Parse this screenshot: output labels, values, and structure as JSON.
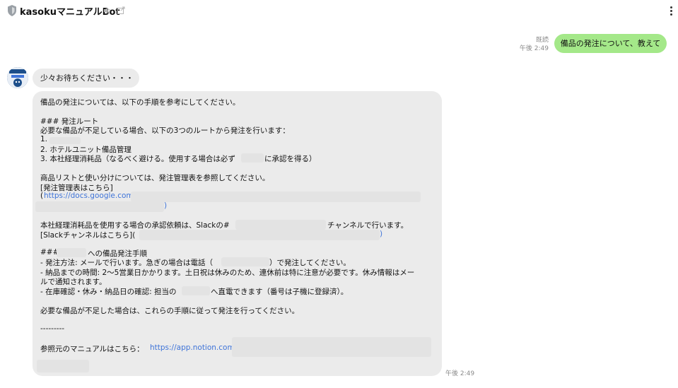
{
  "header": {
    "title": "kasokuマニュアルBot"
  },
  "outgoing": {
    "read_label": "既読",
    "time": "午後 2:49",
    "text": "備品の発注について、教えて"
  },
  "incoming": {
    "waiting_text": "少々お待ちください・・・",
    "time": "午後 2:49",
    "lines": {
      "l1": "備品の発注については、以下の手順を参考にしてください。",
      "l2": "### 発注ルート",
      "l3": "必要な備品が不足している場合、以下の3つのルートから発注を行います：",
      "l4": "1.",
      "l5": "2. ホテルユニット備品管理",
      "l6a": "3. 本社経理消耗品（なるべく避ける。使用する場合は必ず",
      "l6b": "に承認を得る）",
      "l7": "商品リストと使い分けについては、発注管理表を参照してください。",
      "l8": "[発注管理表はこちら]",
      "l9a": "(",
      "l9b": "https://docs.google.com",
      "l10": ")",
      "l11a": "本社経理消耗品を使用する場合の承認依頼は、Slackの#",
      "l11b": "チャンネルで行います。",
      "l12a": "[Slackチャンネルはこちら](",
      "l12b": ")",
      "l13a": "###",
      "l13b": "への備品発注手順",
      "l14a": "- 発注方法: メールで行います。急ぎの場合は電話（",
      "l14b": "）で発注してください。",
      "l15": "- 納品までの時間: 2〜5営業日かかります。土日祝は休みのため、連休前は特に注意が必要です。休み情報はメー",
      "l16": "ルで通知されます。",
      "l17a": "- 在庫確認・休み・納品日の確認: 担当の",
      "l17b": "へ直電できます（番号は子機に登録済）。",
      "l18": "必要な備品が不足した場合は、これらの手順に従って発注を行ってください。",
      "l19": "---------",
      "l20a": "参照元のマニュアルはこちら：",
      "l20b": "https://app.notion.com/"
    }
  },
  "icons": {
    "shield": "shield-icon",
    "mute": "speaker-mute-icon",
    "external": "external-link-icon",
    "menu": "more-vertical-icon"
  },
  "colors": {
    "outgoing_bubble": "#a4e889",
    "incoming_bubble": "#ebebeb",
    "link": "#3f74d8"
  }
}
